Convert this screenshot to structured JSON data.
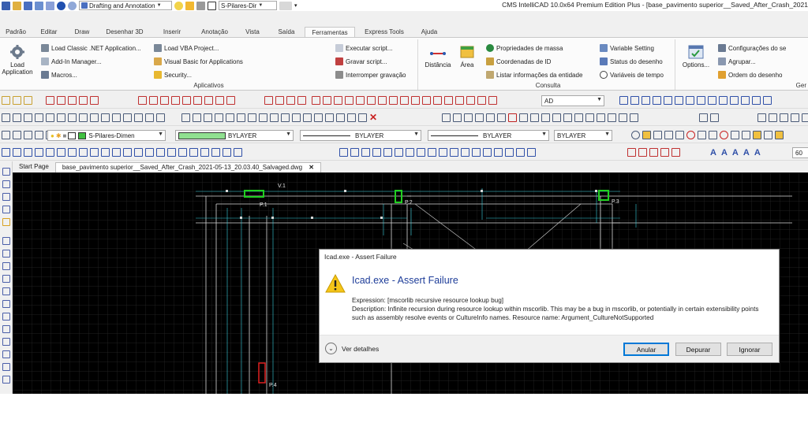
{
  "title_bar": {
    "workspace": "Drafting and Annotation",
    "layer_quick": "S-Pilares-Dir",
    "app_title": "CMS IntelliCAD 10.0x64 Premium Edition Plus  - [base_pavimento superior__Saved_After_Crash_2021"
  },
  "ribbon": {
    "tabs": [
      "Padrão",
      "Editar",
      "Draw",
      "Desenhar 3D",
      "Inserir",
      "Anotação",
      "Vista",
      "Saída",
      "Ferramentas",
      "Express Tools",
      "Ajuda"
    ],
    "active_tab": "Ferramentas",
    "aplicativos": {
      "label": "Aplicativos",
      "load_application": "Load\nApplication",
      "items": [
        "Load Classic .NET Application...",
        "Add-In Manager...",
        "Macros...",
        "Load VBA Project...",
        "Visual Basic for Applications",
        "Security..."
      ]
    },
    "script_items": [
      "Executar script...",
      "Gravar script...",
      "Interromper gravação"
    ],
    "consulta": {
      "label": "Consulta",
      "distancia": "Distância",
      "area": "Área",
      "items": [
        "Propriedades de massa",
        "Coordenadas de ID",
        "Listar informações da entidade",
        "Variable Setting",
        "Status do desenho",
        "Variáveis de tempo"
      ]
    },
    "options": "Options...",
    "ger_items": [
      "Configurações do se",
      "Agrupar...",
      "Ordem do desenho"
    ],
    "ger_label": "Ger"
  },
  "toolbars": {
    "dimstyle": "AD",
    "layer": "S-Pilares-Dimen",
    "color": "BYLAYER",
    "linetype": "BYLAYER",
    "lineweight": "BYLAYER",
    "plotstyle": "BYLAYER",
    "value": "60"
  },
  "doc_tabs": [
    "Start Page",
    "base_pavimento superior__Saved_After_Crash_2021-05-13_20.03.40_Salvaged.dwg"
  ],
  "drawing": {
    "labels": [
      "V.1",
      "P.1",
      "P.2",
      "P.3",
      "P.4"
    ]
  },
  "dialog": {
    "title": "Icad.exe - Assert Failure",
    "heading": "Icad.exe - Assert Failure",
    "expression": "Expression: [mscorlib recursive resource lookup bug]",
    "description": "Description: Infinite recursion during resource lookup within mscorlib.  This may be a bug in mscorlib, or potentially in certain extensibility points such as assembly resolve events or CultureInfo names.  Resource name: Argument_CultureNotSupported",
    "details_label": "Ver detalhes",
    "buttons": [
      "Anular",
      "Depurar",
      "Ignorar"
    ]
  }
}
